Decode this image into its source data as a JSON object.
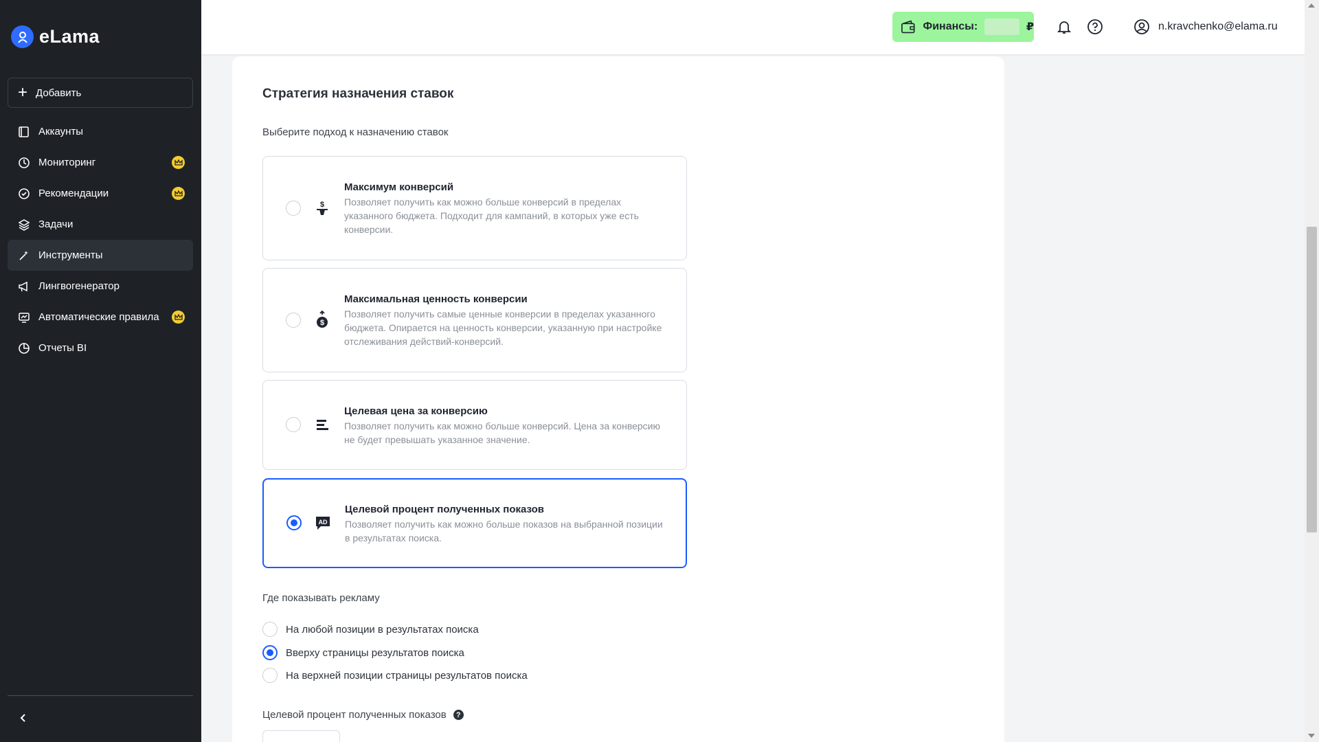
{
  "app": {
    "logo_text": "eLama"
  },
  "sidebar": {
    "add_label": "Добавить",
    "items": [
      {
        "label": "Аккаунты",
        "icon": "accounts-icon",
        "premium": false,
        "active": false
      },
      {
        "label": "Мониторинг",
        "icon": "monitoring-icon",
        "premium": true,
        "active": false
      },
      {
        "label": "Рекомендации",
        "icon": "recommendations-icon",
        "premium": true,
        "active": false
      },
      {
        "label": "Задачи",
        "icon": "tasks-icon",
        "premium": false,
        "active": false
      },
      {
        "label": "Инструменты",
        "icon": "tools-icon",
        "premium": false,
        "active": true
      },
      {
        "label": "Лингвогенератор",
        "icon": "megaphone-icon",
        "premium": false,
        "active": false
      },
      {
        "label": "Автоматические правила",
        "icon": "rules-icon",
        "premium": true,
        "active": false
      },
      {
        "label": "Отчеты BI",
        "icon": "reports-icon",
        "premium": false,
        "active": false
      }
    ]
  },
  "header": {
    "finance_label": "Финансы:",
    "currency": "₽",
    "user_email": "n.kravchenko@elama.ru"
  },
  "main": {
    "section_title": "Стратегия назначения ставок",
    "subtitle": "Выберите подход к назначению ставок",
    "strategies": [
      {
        "title": "Максимум конверсий",
        "description": "Позволяет получить как можно больше конверсий в пределах указанного бюджета. Подходит для кампаний, в которых уже есть конверсии.",
        "selected": false
      },
      {
        "title": "Максимальная ценность конверсии",
        "description": "Позволяет получить самые ценные конверсии в пределах указанного бюджета. Опирается на ценность конверсии, указанную при настройке отслеживания действий-конверсий.",
        "selected": false
      },
      {
        "title": "Целевая цена за конверсию",
        "description": "Позволяет получить как можно больше конверсий. Цена за конверсию не будет превышать указанное значение.",
        "selected": false
      },
      {
        "title": "Целевой процент полученных показов",
        "description": "Позволяет получить как можно больше показов на выбранной позиции в результатах поиска.",
        "selected": true
      }
    ],
    "where_label": "Где показывать рекламу",
    "where_options": [
      {
        "label": "На любой позиции в результатах поиска",
        "selected": false
      },
      {
        "label": "Вверху страницы результатов поиска",
        "selected": true
      },
      {
        "label": "На верхней позиции страницы результатов поиска",
        "selected": false
      }
    ],
    "target_label": "Целевой процент полученных показов",
    "help_glyph": "?"
  },
  "colors": {
    "accent": "#1a5cff",
    "sidebar_bg": "#1e2227",
    "finance_bg": "#9cf59c",
    "premium": "#f5cc2f"
  }
}
